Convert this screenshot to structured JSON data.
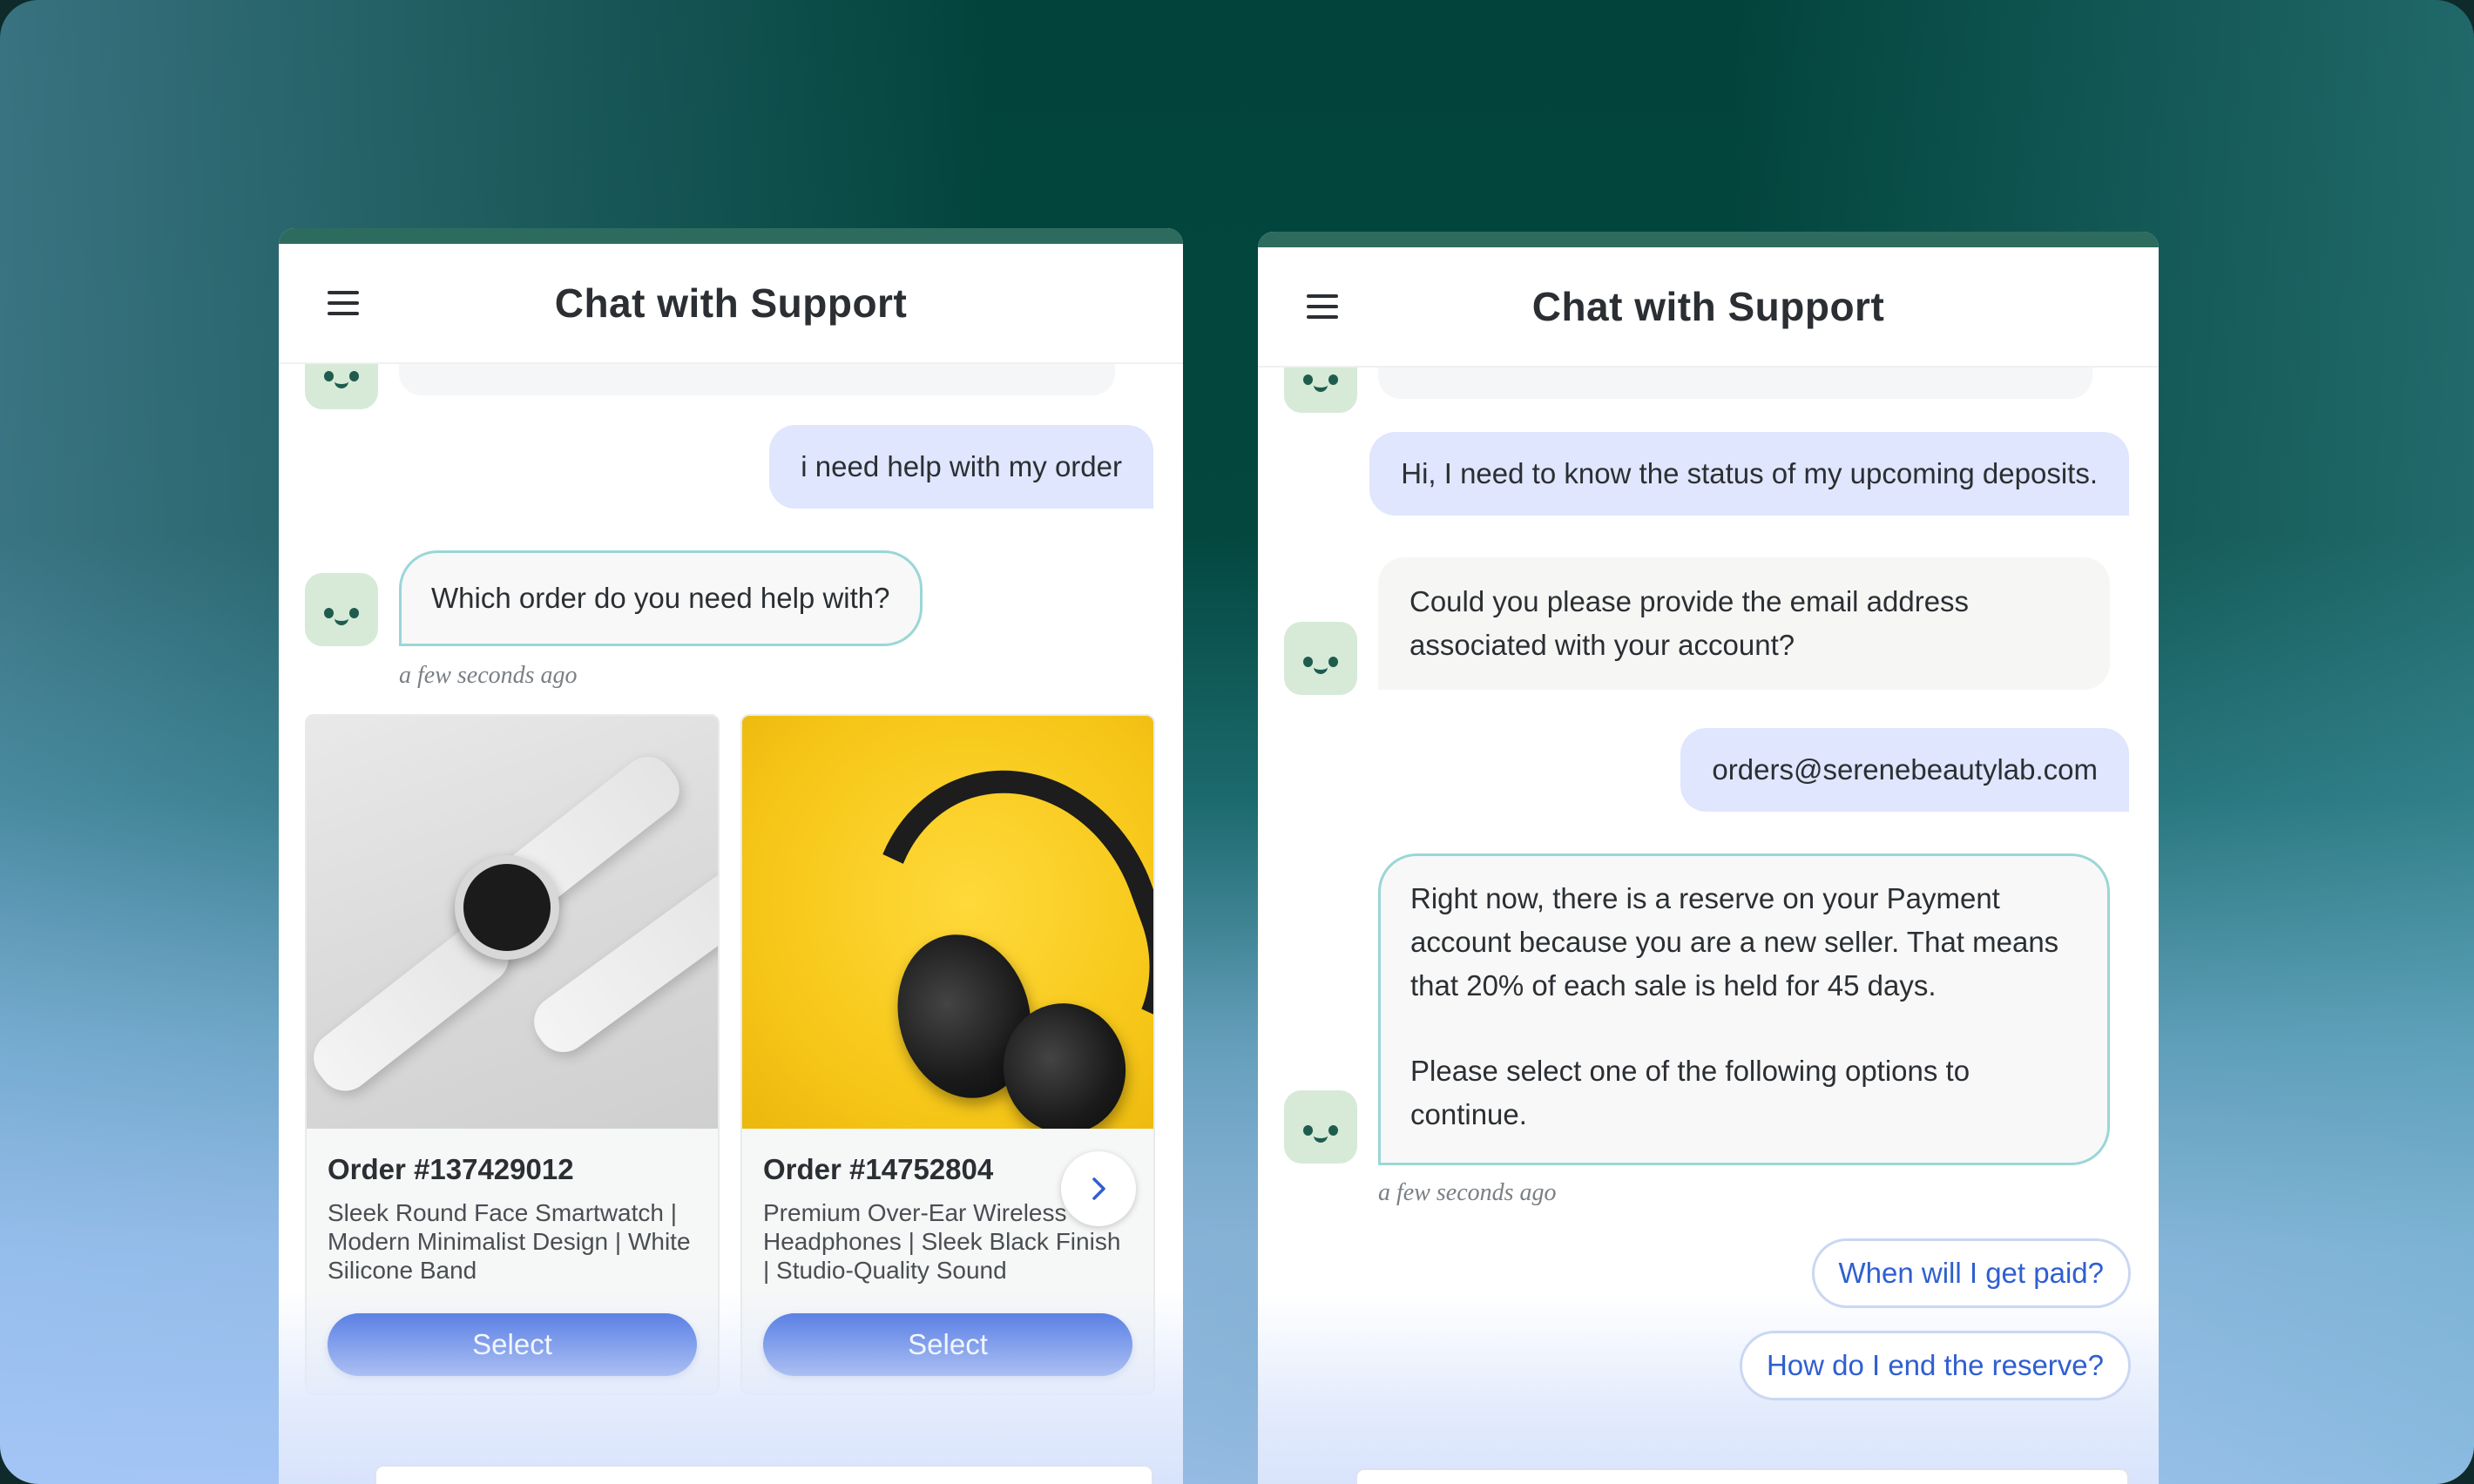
{
  "left_panel": {
    "header_title": "Chat with Support",
    "user_message": "i need help with my order",
    "bot_message": "Which order do you need help with?",
    "timestamp": "a few seconds ago",
    "orders": [
      {
        "title": "Order #137429012",
        "description": "Sleek Round Face Smartwatch | Modern Minimalist Design | White Silicone Band",
        "button": "Select",
        "image": "smartwatch"
      },
      {
        "title": "Order #14752804",
        "description": "Premium Over-Ear Wireless Headphones | Sleek Black Finish | Studio-Quality Sound",
        "button": "Select",
        "image": "headphones"
      }
    ]
  },
  "right_panel": {
    "header_title": "Chat with Support",
    "user_message_1": "Hi, I need to know the status of my upcoming deposits.",
    "bot_message_1": "Could you please provide the email address associated with your account?",
    "user_message_2": "orders@serenebeautylab.com",
    "bot_message_2_p1": "Right now, there is a reserve on your Payment account because you are a new seller. That means that 20% of each sale is held for 45 days.",
    "bot_message_2_p2": "Please select one of the following options to continue.",
    "timestamp": "a few seconds ago",
    "quick_replies": [
      "When will I get paid?",
      "How do I end the reserve?"
    ]
  },
  "icons": {
    "menu": "hamburger-menu-icon",
    "avatar": "bot-smiley-avatar",
    "carousel_next": "chevron-right-icon"
  },
  "colors": {
    "brand_dark_green": "#02443c",
    "user_bubble": "#dfe6fd",
    "bot_bubble": "#f6f6f5",
    "highlight_border": "#9ad6d8",
    "primary_button": "#3f6ae0",
    "quick_reply_text": "#2f5fd0"
  }
}
